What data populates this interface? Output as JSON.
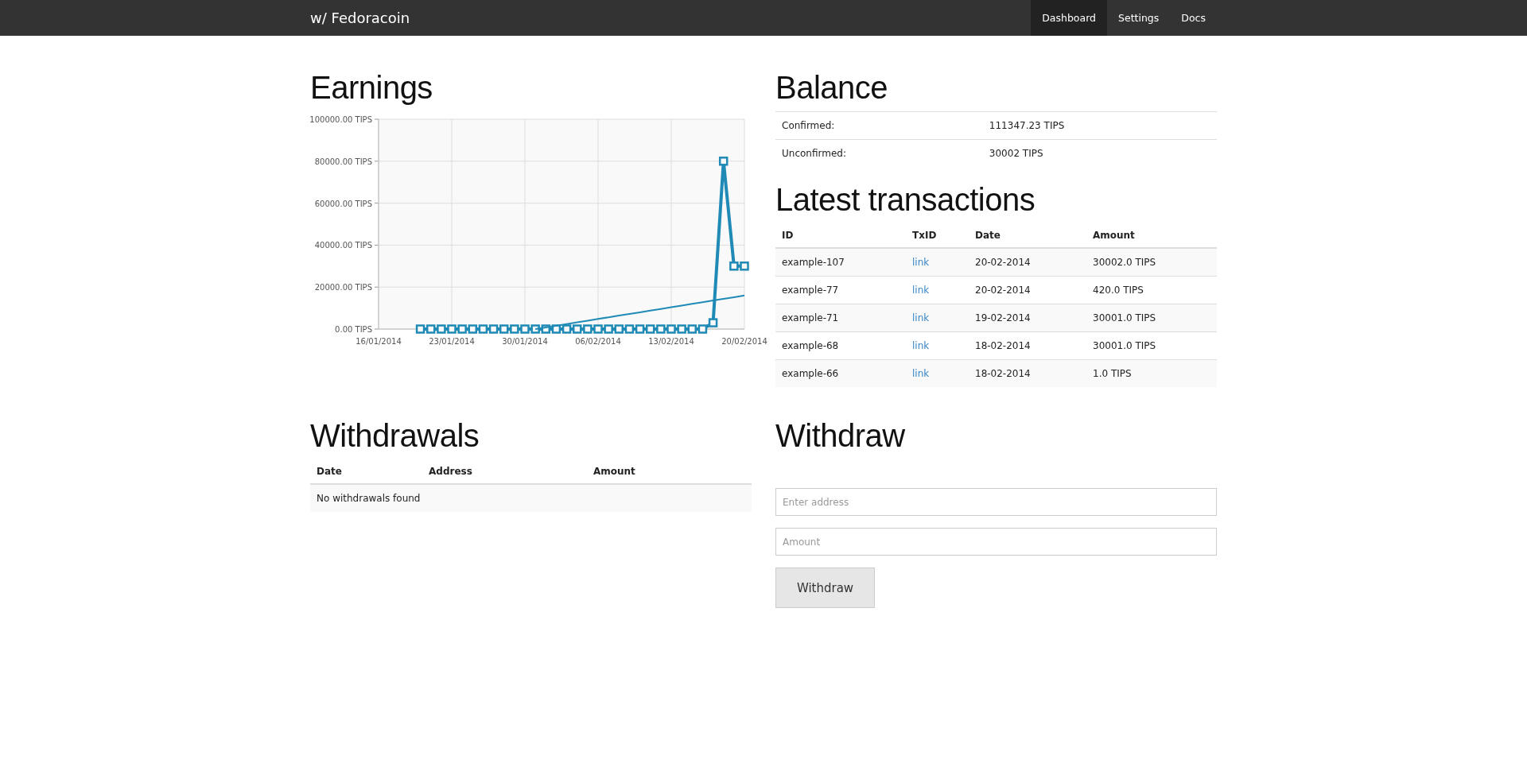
{
  "navbar": {
    "brand": "w/ Fedoracoin",
    "items": [
      {
        "label": "Dashboard",
        "selected": true
      },
      {
        "label": "Settings",
        "selected": false
      },
      {
        "label": "Docs",
        "selected": false
      }
    ]
  },
  "earnings": {
    "title": "Earnings",
    "chart_data": {
      "type": "line",
      "grid": true,
      "ylim": [
        0,
        100000
      ],
      "categories": [
        "16/01/2014",
        null,
        null,
        null,
        null,
        null,
        null,
        "23/01/2014",
        null,
        null,
        null,
        null,
        null,
        null,
        "30/01/2014",
        null,
        null,
        null,
        null,
        null,
        null,
        "06/02/2014",
        null,
        null,
        null,
        null,
        null,
        null,
        "13/02/2014",
        null,
        null,
        null,
        null,
        null,
        null,
        "20/02/2014"
      ],
      "yticks": [
        {
          "value": 0,
          "label": "0.00 TIPS"
        },
        {
          "value": 20000,
          "label": "20000.00 TIPS"
        },
        {
          "value": 40000,
          "label": "40000.00 TIPS"
        },
        {
          "value": 60000,
          "label": "60000.00 TIPS"
        },
        {
          "value": 80000,
          "label": "80000.00 TIPS"
        },
        {
          "value": 100000,
          "label": "100000.00 TIPS"
        }
      ],
      "series": [
        {
          "color": "#1f8ab5",
          "marker": "square",
          "values": [
            null,
            null,
            null,
            null,
            0,
            0,
            0,
            0,
            0,
            0,
            0,
            0,
            0,
            0,
            0,
            0,
            0,
            0,
            0,
            0,
            0,
            0,
            0,
            0,
            0,
            0,
            0,
            0,
            0,
            0,
            0,
            0,
            3000,
            80000,
            30000,
            30000
          ]
        },
        {
          "color": "#1f8ab5",
          "values": [
            null,
            null,
            null,
            null,
            null,
            null,
            null,
            null,
            null,
            null,
            null,
            null,
            null,
            null,
            null,
            0,
            800,
            1600,
            2400,
            3200,
            4000,
            4800,
            5600,
            6400,
            7200,
            8000,
            8800,
            9600,
            10400,
            11200,
            12000,
            12800,
            13600,
            14400,
            15200,
            16000
          ]
        }
      ]
    }
  },
  "balance": {
    "title": "Balance",
    "rows": [
      {
        "label": "Confirmed:",
        "value": "111347.23 TIPS"
      },
      {
        "label": "Unconfirmed:",
        "value": "30002 TIPS"
      }
    ]
  },
  "transactions": {
    "title": "Latest transactions",
    "columns": [
      "ID",
      "TxID",
      "Date",
      "Amount"
    ],
    "rows": [
      {
        "id": "example-107",
        "txid": "link",
        "date": "20-02-2014",
        "amount": "30002.0 TIPS"
      },
      {
        "id": "example-77",
        "txid": "link",
        "date": "20-02-2014",
        "amount": "420.0 TIPS"
      },
      {
        "id": "example-71",
        "txid": "link",
        "date": "19-02-2014",
        "amount": "30001.0 TIPS"
      },
      {
        "id": "example-68",
        "txid": "link",
        "date": "18-02-2014",
        "amount": "30001.0 TIPS"
      },
      {
        "id": "example-66",
        "txid": "link",
        "date": "18-02-2014",
        "amount": "1.0 TIPS"
      }
    ]
  },
  "withdrawals": {
    "title": "Withdrawals",
    "columns": [
      "Date",
      "Address",
      "Amount"
    ],
    "empty_message": "No withdrawals found"
  },
  "withdraw": {
    "title": "Withdraw",
    "address": {
      "placeholder": "Enter address"
    },
    "amount": {
      "placeholder": "Amount"
    },
    "button": "Withdraw"
  }
}
